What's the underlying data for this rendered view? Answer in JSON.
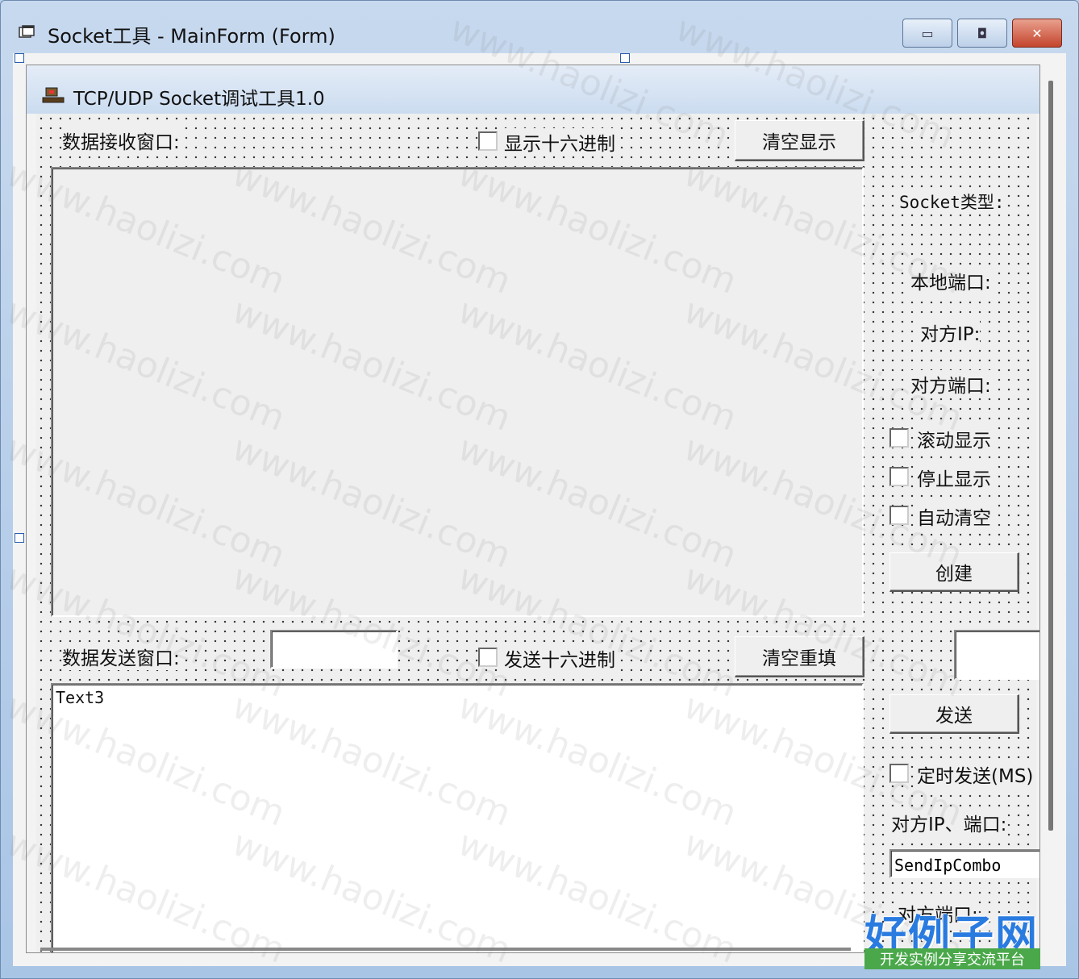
{
  "window": {
    "title": "Socket工具 - MainForm (Form)",
    "minimize_glyph": "▭",
    "maximize_glyph": "◘",
    "close_glyph": "✕"
  },
  "form": {
    "title": "TCP/UDP Socket调试工具1.0"
  },
  "receive": {
    "label": "数据接收窗口:",
    "hex_checkbox_label": "显示十六进制",
    "clear_button": "清空显示"
  },
  "send": {
    "label": "数据发送窗口:",
    "hex_checkbox_label": "发送十六进制",
    "clear_button": "清空重填",
    "textarea_text": "Text3"
  },
  "side": {
    "socket_type_label": "Socket类型:",
    "local_port_label": "本地端口:",
    "remote_ip_label": "对方IP:",
    "remote_port_label": "对方端口:",
    "scroll_display": "滚动显示",
    "stop_display": "停止显示",
    "auto_clear": "自动清空",
    "create_button": "创建",
    "send_button": "发送",
    "timed_send": "定时发送(MS)",
    "remote_ip_port_label": "对方IP、端口:",
    "send_ip_combo": "SendIpCombo",
    "remote_port_label2": "对方端口:"
  },
  "watermark": {
    "text": "www.haolizi.com"
  },
  "logo": {
    "main": "好例子网",
    "sub": "开发实例分享交流平台"
  },
  "colors": {
    "form_bg": "#efefef",
    "title_gradient_top": "#c7d9ee",
    "close_red": "#c4442c",
    "logo_blue": "#2a7be0",
    "logo_green": "#4aa84a"
  }
}
